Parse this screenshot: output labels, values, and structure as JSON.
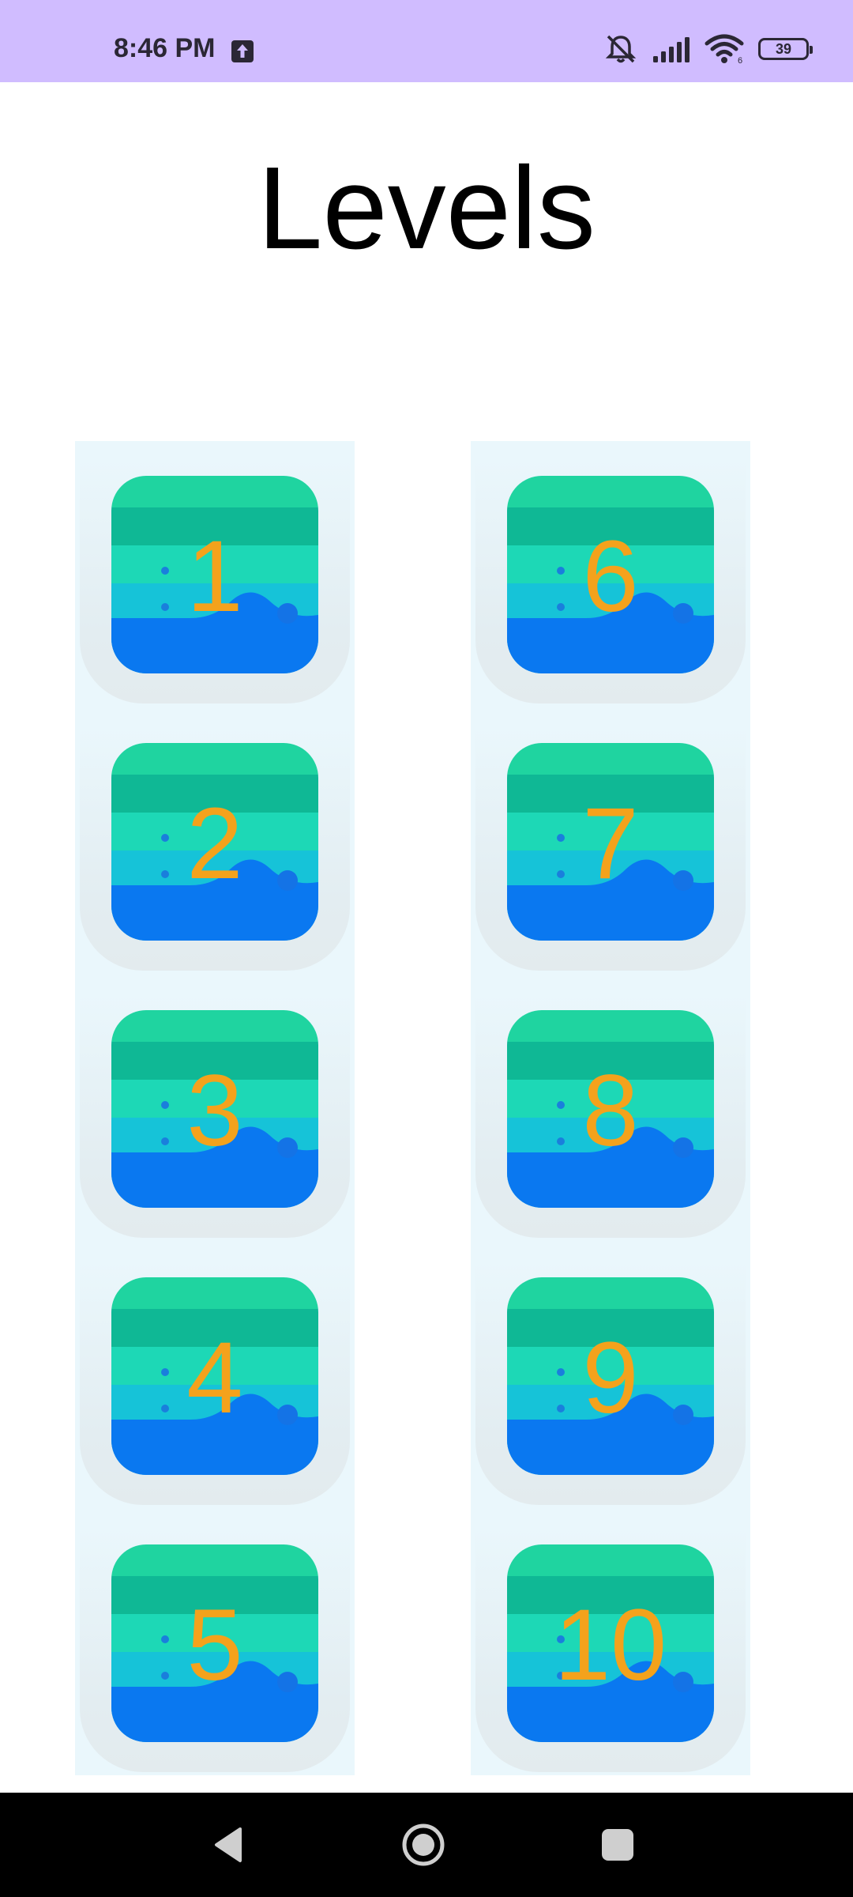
{
  "status_bar": {
    "time": "8:46 PM",
    "battery_level": "39",
    "icons": [
      "upload-icon",
      "notifications-muted-icon",
      "signal-icon",
      "wifi-icon",
      "battery-icon"
    ],
    "background_color": "#d0bcff"
  },
  "page": {
    "title": "Levels"
  },
  "levels": [
    {
      "label": "1"
    },
    {
      "label": "2"
    },
    {
      "label": "3"
    },
    {
      "label": "4"
    },
    {
      "label": "5"
    },
    {
      "label": "6"
    },
    {
      "label": "7"
    },
    {
      "label": "8"
    },
    {
      "label": "9"
    },
    {
      "label": "10"
    }
  ],
  "colors": {
    "level_number": "#f4a21c",
    "tile_top": "#1fd4a0",
    "tile_bottom": "#0a78f0",
    "column_background": "#eaf7fc"
  },
  "nav_bar": {
    "buttons": [
      "back-icon",
      "home-icon",
      "recents-icon"
    ]
  }
}
